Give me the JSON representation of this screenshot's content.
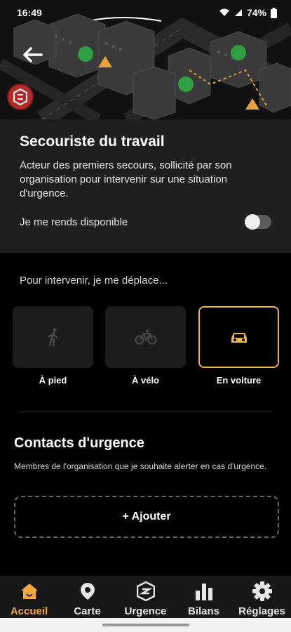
{
  "status_bar": {
    "time": "16:49",
    "battery": "74%"
  },
  "hero": {
    "back_icon": "arrow-left-icon",
    "pin_icon": "red-location-pin-icon"
  },
  "info_card": {
    "title": "Secouriste du travail",
    "description": "Acteur des premiers secours, sollicité par son organisation pour intervenir sur une situation d'urgence.",
    "availability_label": "Je me rends disponible",
    "availability_on": false
  },
  "movement": {
    "label": "Pour intervenir, je me déplace...",
    "options": [
      {
        "label": "À pied",
        "icon": "walking-icon",
        "selected": false
      },
      {
        "label": "À vélo",
        "icon": "bike-icon",
        "selected": false
      },
      {
        "label": "En voiture",
        "icon": "car-icon",
        "selected": true
      }
    ]
  },
  "contacts": {
    "title": "Contacts d'urgence",
    "description": "Membres de l'organisation que je souhaite alerter en cas d'urgence.",
    "add_label": "+ Ajouter"
  },
  "nav": {
    "items": [
      {
        "label": "Accueil",
        "icon": "home-icon",
        "active": true
      },
      {
        "label": "Carte",
        "icon": "map-pin-icon",
        "active": false
      },
      {
        "label": "Urgence",
        "icon": "emergency-shield-icon",
        "active": false
      },
      {
        "label": "Bilans",
        "icon": "bar-chart-icon",
        "active": false
      },
      {
        "label": "Réglages",
        "icon": "gear-icon",
        "active": false
      }
    ]
  },
  "colors": {
    "accent": "#f0a93a",
    "selected_border": "#e9b54b",
    "card_bg": "#1f1f1f",
    "map_marker_green": "#2ea043"
  }
}
